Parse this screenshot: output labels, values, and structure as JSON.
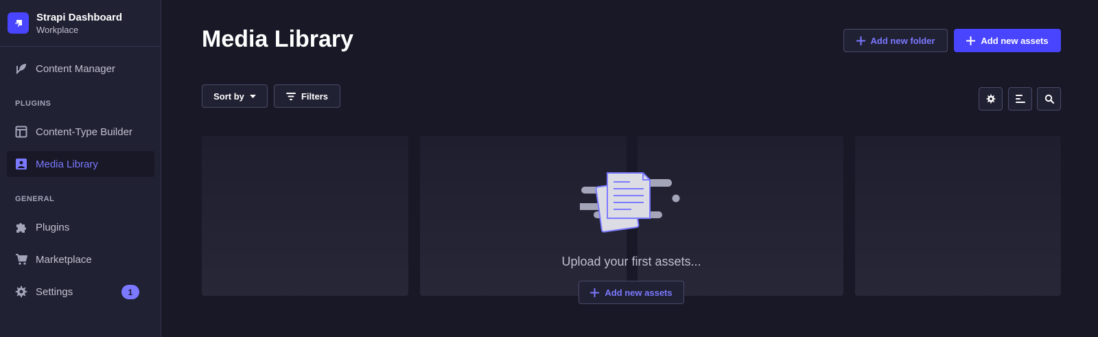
{
  "brand": {
    "title": "Strapi Dashboard",
    "subtitle": "Workplace",
    "accent": "#4945ff"
  },
  "sidebar": {
    "items": [
      {
        "label": "Content Manager",
        "icon": "feather-icon"
      },
      {
        "label": "Content-Type Builder",
        "icon": "layout-icon"
      },
      {
        "label": "Media Library",
        "icon": "picture-icon",
        "active": true
      },
      {
        "label": "Plugins",
        "icon": "puzzle-icon"
      },
      {
        "label": "Marketplace",
        "icon": "cart-icon"
      },
      {
        "label": "Settings",
        "icon": "gear-icon",
        "badge": "1"
      }
    ],
    "sections": {
      "plugins": "PLUGINS",
      "general": "GENERAL"
    }
  },
  "header": {
    "title": "Media Library",
    "add_folder_label": "Add new folder",
    "add_assets_label": "Add new assets"
  },
  "toolbar": {
    "sort_label": "Sort by",
    "filters_label": "Filters",
    "icons": [
      "gear-icon",
      "list-view-icon",
      "search-icon"
    ]
  },
  "empty_state": {
    "message": "Upload your first assets...",
    "button_label": "Add new assets",
    "icon": "documents-illustration"
  },
  "colors": {
    "background": "#181826",
    "sidebar": "#212134",
    "accent": "#7b79ff",
    "primary": "#4945ff"
  }
}
